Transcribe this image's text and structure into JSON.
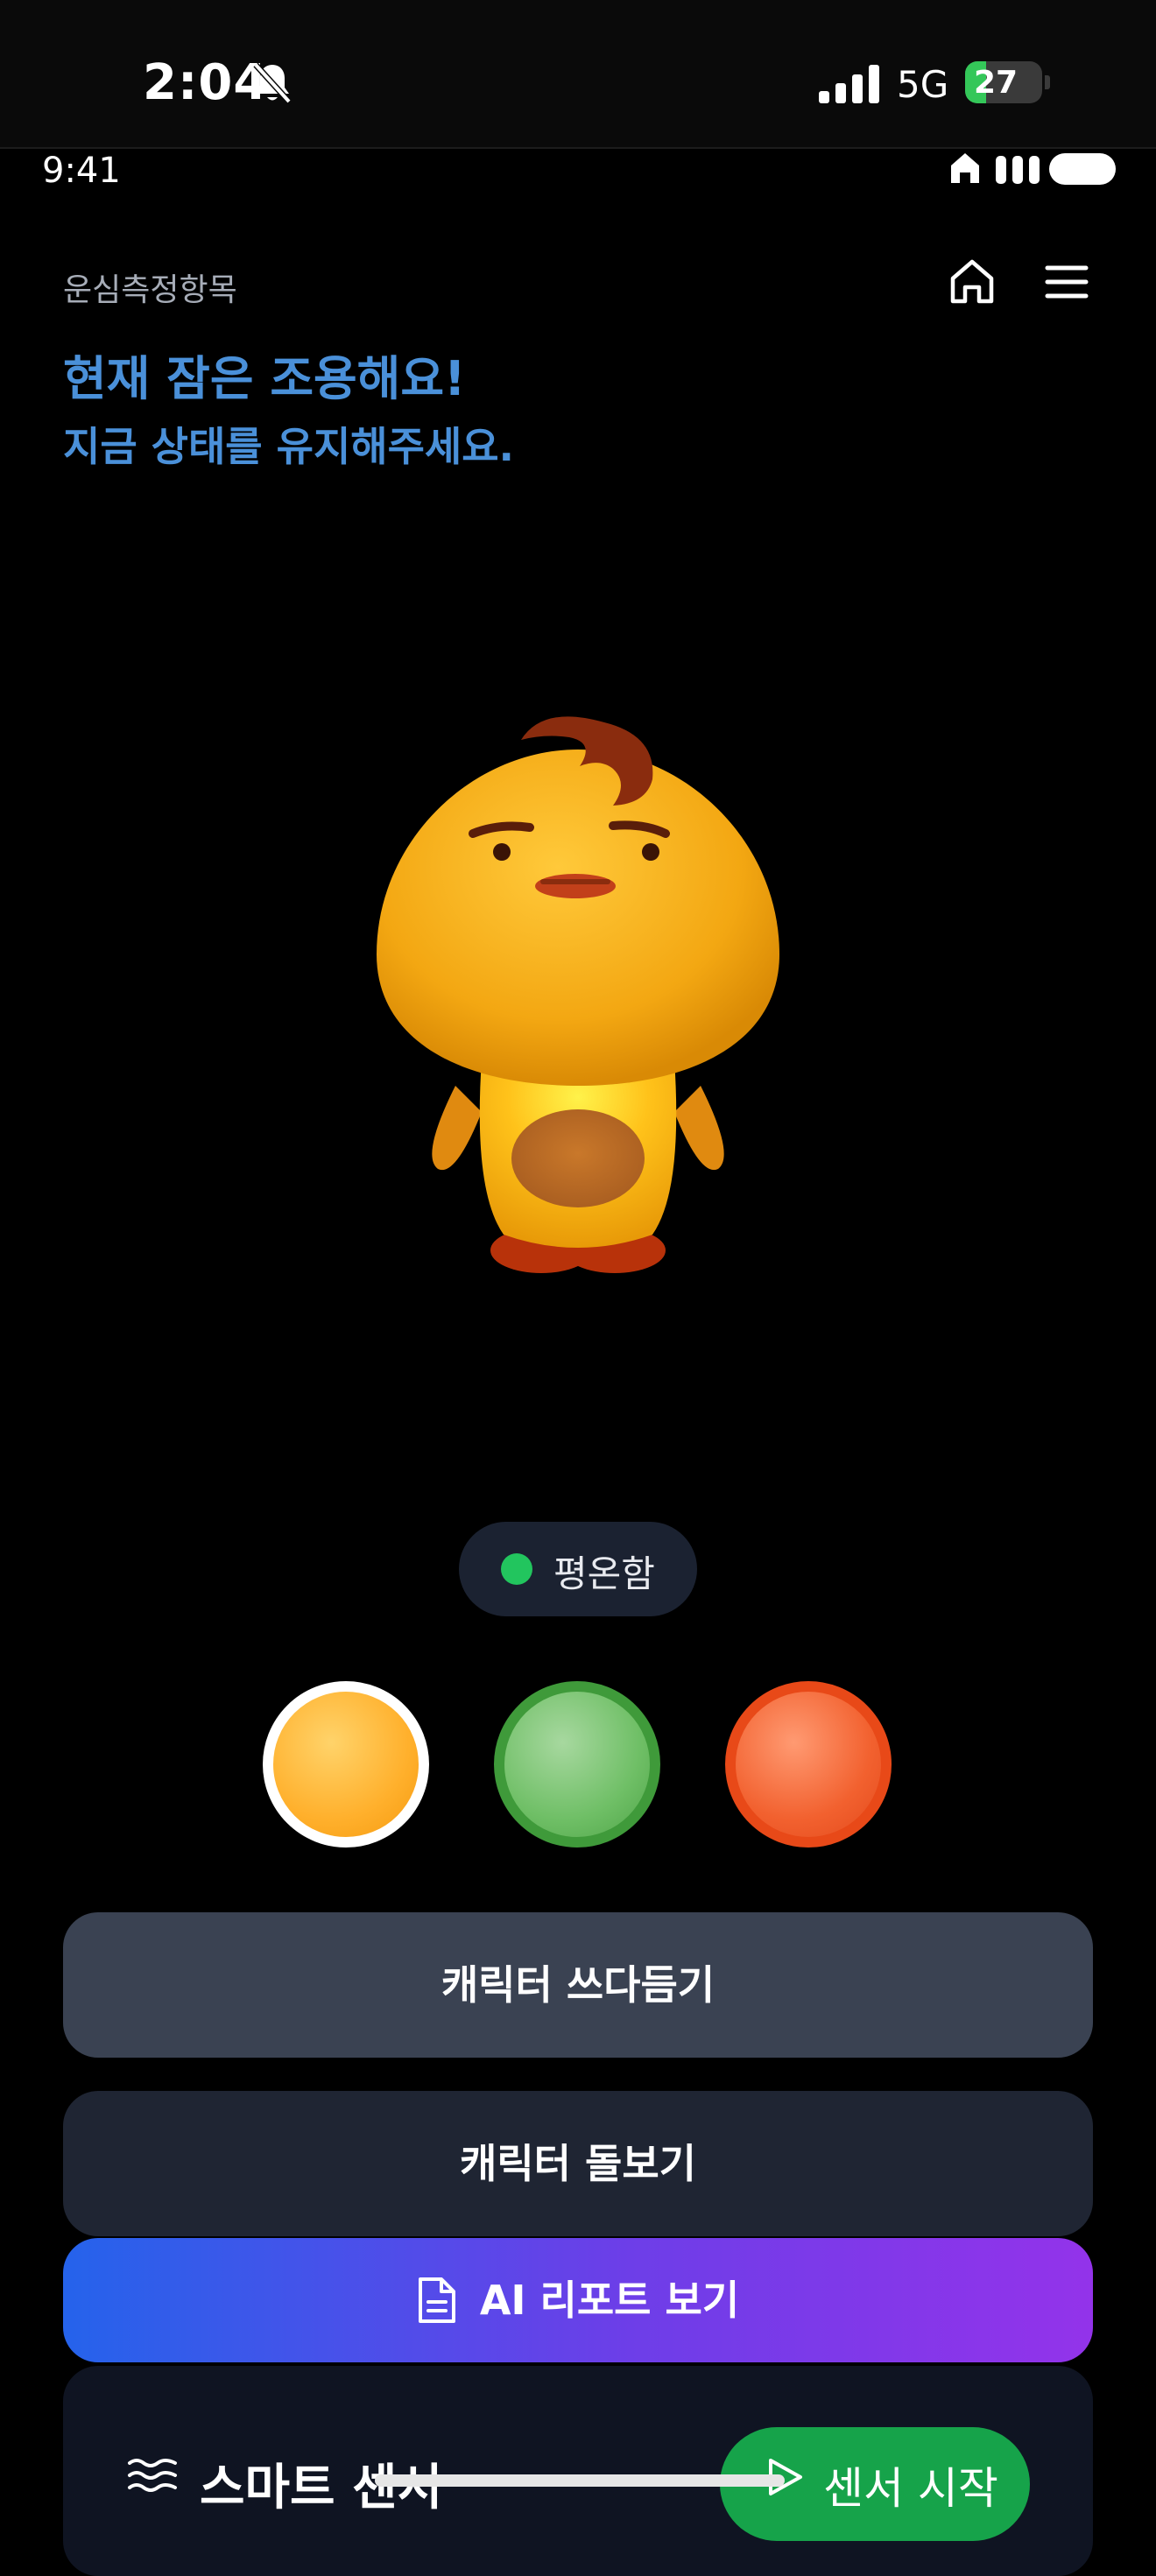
{
  "system_status": {
    "time": "2:04",
    "network": "5G",
    "battery_percent": "27",
    "battery_level": 0.27,
    "icons": [
      "bell-slash-icon",
      "signal-icon",
      "battery-icon"
    ]
  },
  "inner_status": {
    "time": "9:41",
    "icons": [
      "home-icon",
      "signal-bars-icon",
      "battery-pill-icon"
    ]
  },
  "header": {
    "section_label": "운심측정항목",
    "headline": "현재 잠은 조용해요!",
    "subline": "지금 상태를 유지해주세요."
  },
  "status": {
    "label": "평온함",
    "dot_color": "#22c55e"
  },
  "color_options": [
    {
      "name": "yellow",
      "color": "#ffb02c",
      "selected": true
    },
    {
      "name": "green",
      "color": "#6fbf66",
      "selected": false
    },
    {
      "name": "red",
      "color": "#f2612f",
      "selected": false
    }
  ],
  "buttons": {
    "stretch": "캐릭터 쓰다듬기",
    "care": "캐릭터 돌보기",
    "report": "AI 리포트 보기"
  },
  "sensor": {
    "title": "스마트 센서",
    "start": "센서 시작"
  }
}
